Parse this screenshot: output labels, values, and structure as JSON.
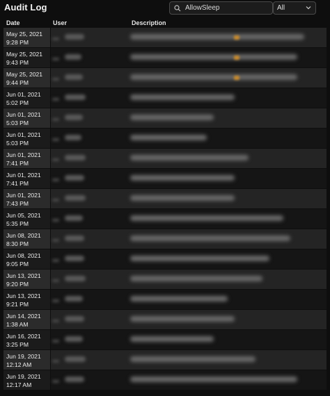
{
  "header": {
    "title": "Audit Log",
    "search_value": "AllowSleep",
    "filter_value": "All"
  },
  "columns": {
    "date": "Date",
    "user": "User",
    "description": "Description"
  },
  "rows": [
    {
      "date": "May 25, 2021",
      "time": "9:28 PM"
    },
    {
      "date": "May 25, 2021",
      "time": "9:43 PM"
    },
    {
      "date": "May 25, 2021",
      "time": "9:44 PM"
    },
    {
      "date": "Jun 01, 2021",
      "time": "5:02 PM"
    },
    {
      "date": "Jun 01, 2021",
      "time": "5:03 PM"
    },
    {
      "date": "Jun 01, 2021",
      "time": "5:03 PM"
    },
    {
      "date": "Jun 01, 2021",
      "time": "7:41 PM"
    },
    {
      "date": "Jun 01, 2021",
      "time": "7:41 PM"
    },
    {
      "date": "Jun 01, 2021",
      "time": "7:43 PM"
    },
    {
      "date": "Jun 05, 2021",
      "time": "5:35 PM"
    },
    {
      "date": "Jun 08, 2021",
      "time": "8:30 PM"
    },
    {
      "date": "Jun 08, 2021",
      "time": "9:05 PM"
    },
    {
      "date": "Jun 13, 2021",
      "time": "9:20 PM"
    },
    {
      "date": "Jun 13, 2021",
      "time": "9:21 PM"
    },
    {
      "date": "Jun 14, 2021",
      "time": "1:38 AM"
    },
    {
      "date": "Jun 16, 2021",
      "time": "3:25 PM"
    },
    {
      "date": "Jun 19, 2021",
      "time": "12:12 AM"
    },
    {
      "date": "Jun 19, 2021",
      "time": "12:17 AM"
    }
  ],
  "colors": {
    "accent_marker": "#c98a2a"
  },
  "icons": {
    "search": "search-icon",
    "dropdown": "chevron-down-icon"
  }
}
